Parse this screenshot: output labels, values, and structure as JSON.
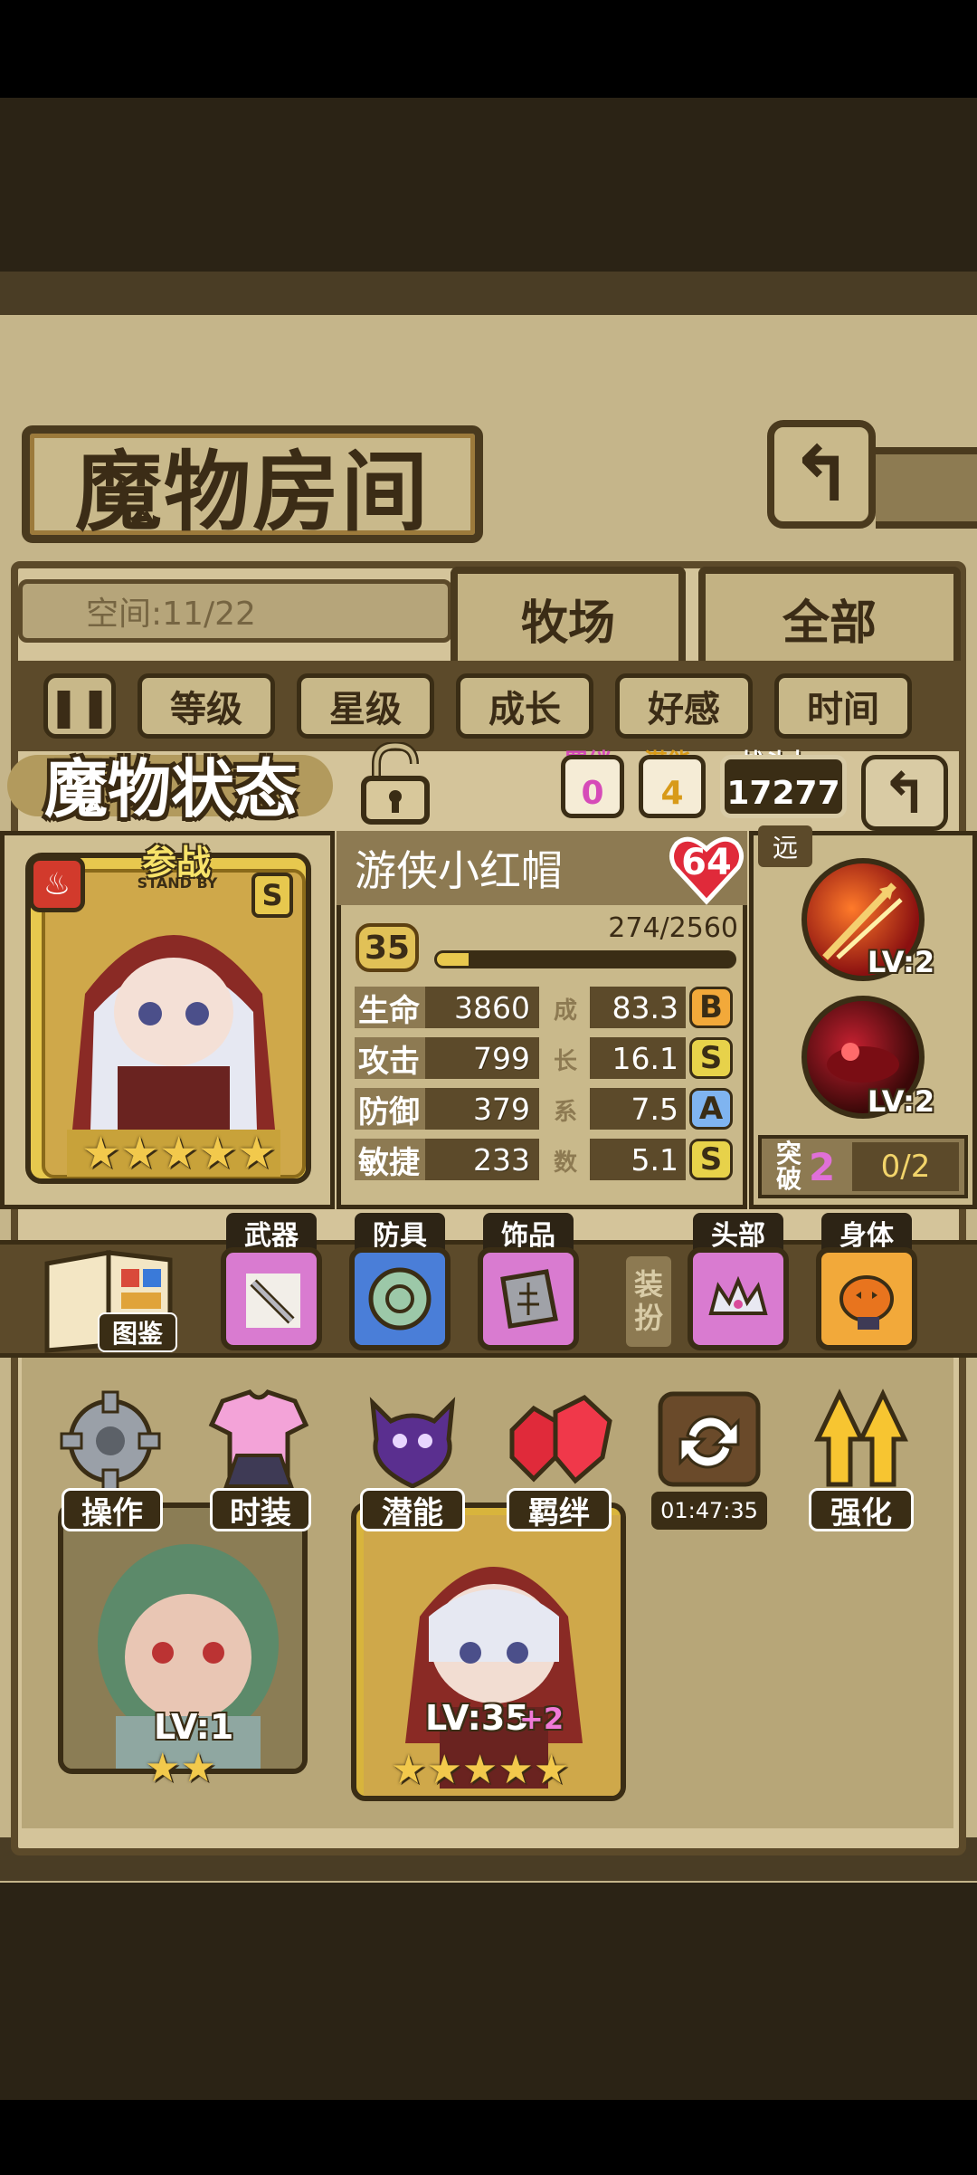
{
  "header": {
    "title": "魔物房间",
    "back_icon": "return-arrow-icon"
  },
  "room": {
    "space_label": "空间:11/22",
    "tabs": [
      "牧场",
      "全部"
    ]
  },
  "sort": {
    "pause_icon": "pause-icon",
    "buttons": [
      "等级",
      "星级",
      "成长",
      "好感",
      "时间"
    ]
  },
  "status": {
    "title": "魔物状态",
    "bond_label": "羁绊",
    "bond_value": "0",
    "potential_label": "潜能",
    "potential_value": "4",
    "power_label": "战斗力",
    "power_value": "17277",
    "back_icon": "back-arrow-icon"
  },
  "monster": {
    "stand_by": "参战",
    "stand_by_en": "STAND BY",
    "rank_badge": "S",
    "name": "游侠小红帽",
    "affection": "64",
    "level": "35",
    "exp_text": "274/2560",
    "exp_fraction": 0.107,
    "stars": 5,
    "stats": [
      {
        "label": "生命",
        "value": "3860",
        "growth": "83.3",
        "grade": "B"
      },
      {
        "label": "攻击",
        "value": "799",
        "growth": "16.1",
        "grade": "S"
      },
      {
        "label": "防御",
        "value": "379",
        "growth": "7.5",
        "grade": "A"
      },
      {
        "label": "敏捷",
        "value": "233",
        "growth": "5.1",
        "grade": "S"
      }
    ],
    "growth_vertical": [
      "成",
      "长",
      "系",
      "数"
    ]
  },
  "skills": {
    "tag": "远",
    "items": [
      {
        "level": "LV:2"
      },
      {
        "level": "LV:2"
      }
    ],
    "break_label_1": "突",
    "break_label_2": "破",
    "break_value": "2",
    "break_progress": "0/2"
  },
  "equipment": {
    "book_label": "图鉴",
    "slots": [
      "武器",
      "防具",
      "饰品"
    ],
    "dress_label": [
      "装",
      "扮"
    ],
    "costume_slots": [
      "头部",
      "身体"
    ]
  },
  "actions": {
    "buttons": [
      "操作",
      "时装",
      "潜能",
      "羁绊",
      "强化"
    ],
    "timer": "01:47:35"
  },
  "list": {
    "cards": [
      {
        "level": "LV:1",
        "stars": 2
      },
      {
        "level": "LV:35",
        "bonus": "+2",
        "stars": 5
      }
    ]
  },
  "colors": {
    "frame": "#3a2d15",
    "parchment": "#c9b98b",
    "gold": "#e1c157",
    "pink": "#d97bd0",
    "blue": "#4a7ed8"
  }
}
